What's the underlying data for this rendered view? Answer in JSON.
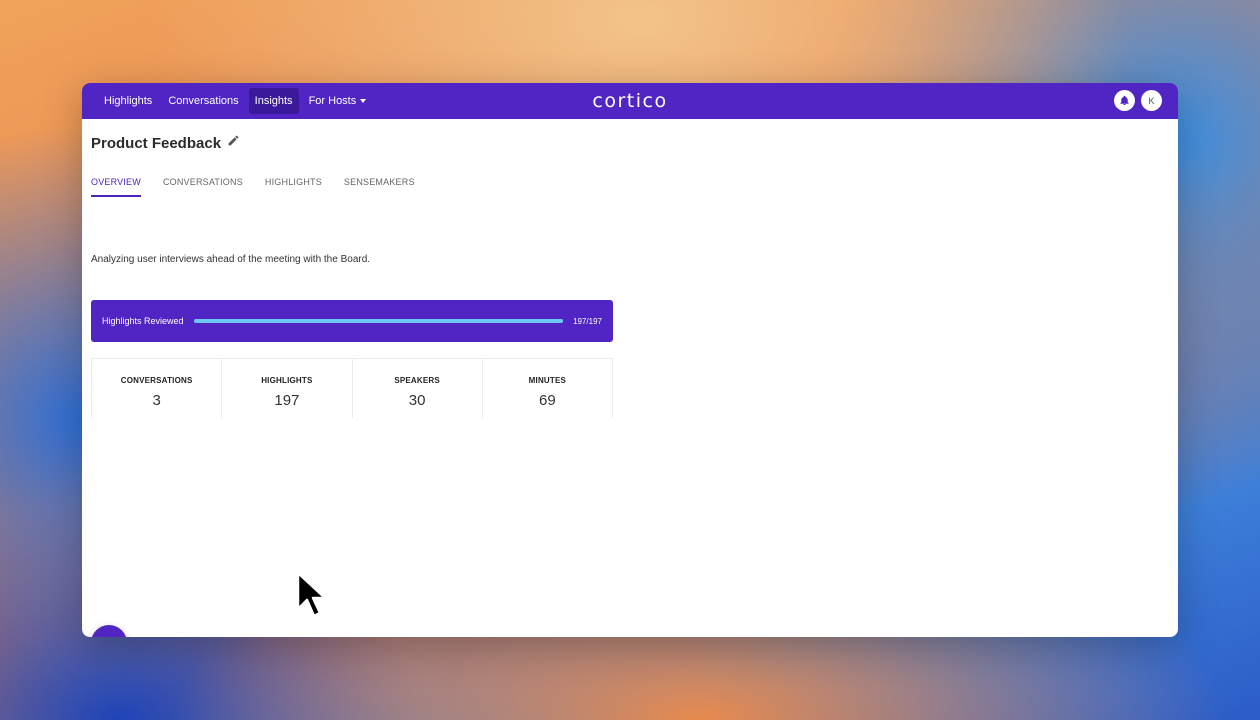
{
  "nav": {
    "items": [
      {
        "label": "Highlights",
        "active": false
      },
      {
        "label": "Conversations",
        "active": false
      },
      {
        "label": "Insights",
        "active": true
      },
      {
        "label": "For Hosts",
        "active": false,
        "dropdown": true
      }
    ],
    "logo": "cortico",
    "avatar_initial": "K"
  },
  "page": {
    "title": "Product Feedback",
    "description": "Analyzing user interviews ahead of the meeting with the Board."
  },
  "tabs": [
    {
      "label": "OVERVIEW",
      "active": true
    },
    {
      "label": "CONVERSATIONS",
      "active": false
    },
    {
      "label": "HIGHLIGHTS",
      "active": false
    },
    {
      "label": "SENSEMAKERS",
      "active": false
    }
  ],
  "progress": {
    "label": "Highlights Reviewed",
    "value_text": "197/197",
    "fraction": 1.0
  },
  "stats": [
    {
      "label": "CONVERSATIONS",
      "value": "3"
    },
    {
      "label": "HIGHLIGHTS",
      "value": "197"
    },
    {
      "label": "SPEAKERS",
      "value": "30"
    },
    {
      "label": "MINUTES",
      "value": "69"
    }
  ],
  "fab": {
    "label": "+"
  },
  "colors": {
    "brand": "#5025c4",
    "active_nav": "#3a1a9a",
    "progress_fill": "#6fc7f5"
  }
}
